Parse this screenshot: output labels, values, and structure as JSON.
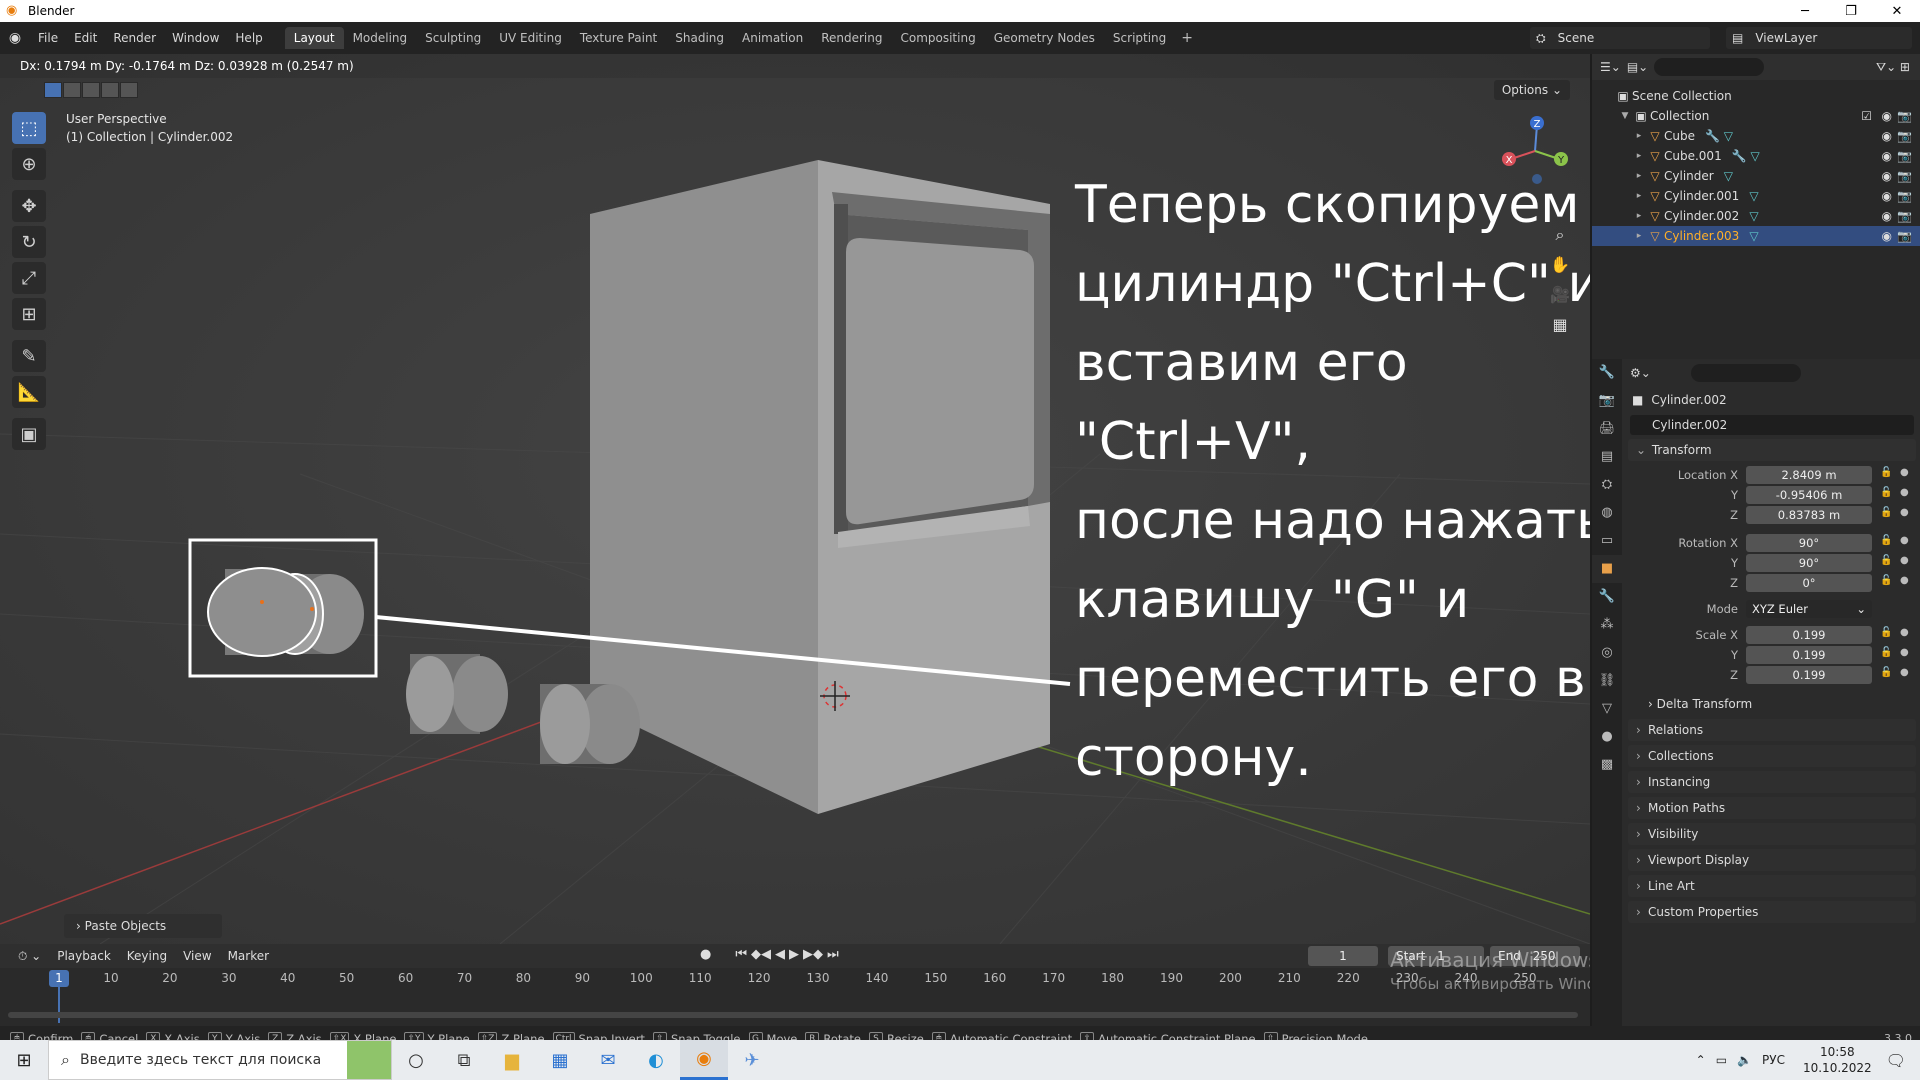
{
  "window": {
    "title": "Blender",
    "minimize": "─",
    "maximize": "❐",
    "close": "✕"
  },
  "menus": [
    "File",
    "Edit",
    "Render",
    "Window",
    "Help"
  ],
  "workspaces": [
    "Layout",
    "Modeling",
    "Sculpting",
    "UV Editing",
    "Texture Paint",
    "Shading",
    "Animation",
    "Rendering",
    "Compositing",
    "Geometry Nodes",
    "Scripting"
  ],
  "workspace_add": "+",
  "scene": {
    "name": "Scene",
    "view_layer": "ViewLayer"
  },
  "viewport": {
    "header_text": "Dx: 0.1794 m  Dy: -0.1764 m  Dz: 0.03928 m (0.2547 m)",
    "perspective": "User Perspective",
    "collection_info": "(1) Collection | Cylinder.002",
    "options_label": "Options",
    "gizmo_axes": {
      "x": "X",
      "y": "Y",
      "z": "Z"
    },
    "annotation_lines": [
      "Теперь скопируем",
      "цилиндр \"Ctrl+C\" и",
      "вставим его \"Ctrl+V\",",
      "после надо нажать",
      "клавишу \"G\" и",
      "переместить его в",
      "сторону."
    ],
    "operator_panel": "Paste Objects"
  },
  "outliner": {
    "root": "Scene Collection",
    "collection": "Collection",
    "objects": [
      {
        "name": "Cube",
        "selected": false
      },
      {
        "name": "Cube.001",
        "selected": false
      },
      {
        "name": "Cylinder",
        "selected": false
      },
      {
        "name": "Cylinder.001",
        "selected": false
      },
      {
        "name": "Cylinder.002",
        "selected": false
      },
      {
        "name": "Cylinder.003",
        "selected": true
      }
    ]
  },
  "properties": {
    "object_name": "Cylinder.002",
    "name_field": "Cylinder.002",
    "transform_label": "Transform",
    "location_label": "Location X",
    "location": [
      "2.8409 m",
      "-0.95406 m",
      "0.83783 m"
    ],
    "rotation_label": "Rotation X",
    "rotation": [
      "90°",
      "90°",
      "0°"
    ],
    "mode_label": "Mode",
    "mode_value": "XYZ Euler",
    "scale_label": "Scale X",
    "scale": [
      "0.199",
      "0.199",
      "0.199"
    ],
    "axis_y": "Y",
    "axis_z": "Z",
    "delta_transform": "Delta Transform",
    "panels": [
      "Relations",
      "Collections",
      "Instancing",
      "Motion Paths",
      "Visibility",
      "Viewport Display",
      "Line Art",
      "Custom Properties"
    ]
  },
  "timeline": {
    "menus": [
      "Playback",
      "Keying",
      "View",
      "Marker"
    ],
    "current_frame": "1",
    "start_label": "Start",
    "start_value": "1",
    "end_label": "End",
    "end_value": "250",
    "ticks": [
      "1",
      "10",
      "20",
      "30",
      "40",
      "50",
      "60",
      "70",
      "80",
      "90",
      "100",
      "110",
      "120",
      "130",
      "140",
      "150",
      "160",
      "170",
      "180",
      "190",
      "200",
      "210",
      "220",
      "230",
      "240",
      "250"
    ]
  },
  "statusbar": {
    "items": [
      "Confirm",
      "Cancel",
      "X Axis",
      "Y Axis",
      "Z Axis",
      "X Plane",
      "Y Plane",
      "Z Plane",
      "Snap Invert",
      "Snap Toggle",
      "Move",
      "Rotate",
      "Resize",
      "Automatic Constraint",
      "Automatic Constraint Plane",
      "Precision Mode"
    ],
    "keys": [
      "",
      "",
      "X",
      "Y",
      "Z",
      "⇧X",
      "⇧Y",
      "⇧Z",
      "Ctrl",
      "⇧",
      "G",
      "R",
      "S",
      "",
      "⇧",
      "⇧"
    ],
    "version": "3.3.0"
  },
  "activation": {
    "line1": "Активация Windows",
    "line2": "Чтобы активировать Windows, перейдите в раздел \"Параметры\"."
  },
  "taskbar": {
    "search_placeholder": "Введите здесь текст для поиска",
    "lang": "РУС",
    "time": "10:58",
    "date": "10.10.2022"
  }
}
